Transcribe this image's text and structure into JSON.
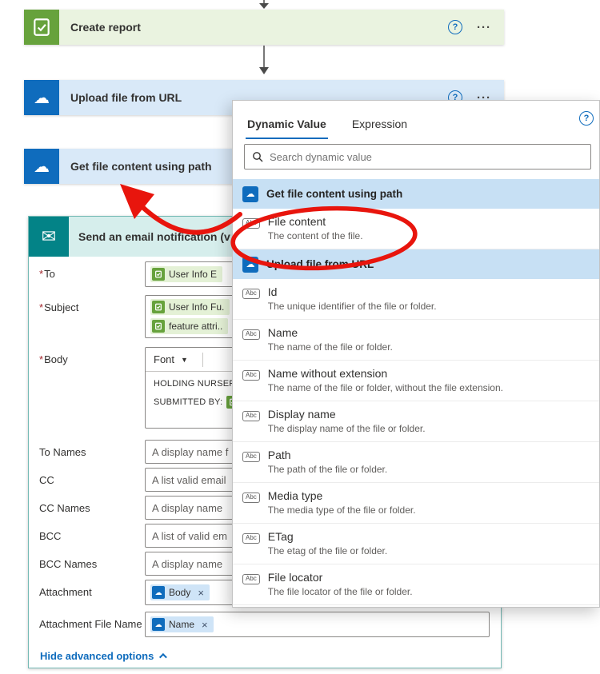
{
  "flow": {
    "create_report": {
      "title": "Create report",
      "help": "?",
      "more": "···"
    },
    "upload_file": {
      "title": "Upload file from URL",
      "help": "?",
      "more": "···"
    },
    "get_file": {
      "title": "Get file content using path"
    },
    "email": {
      "title": "Send an email notification (v",
      "req": "*",
      "fields": {
        "to": {
          "label": "To",
          "token": "User Info E"
        },
        "subject": {
          "label": "Subject",
          "token1": "User Info Fu.",
          "token2": "feature attri.."
        },
        "body": {
          "label": "Body",
          "font": "Font",
          "line1": "HOLDING NURSERY",
          "line2": "SUBMITTED BY:"
        },
        "to_names": {
          "label": "To Names",
          "placeholder": "A display name f"
        },
        "cc": {
          "label": "CC",
          "placeholder": "A list valid email"
        },
        "cc_names": {
          "label": "CC Names",
          "placeholder": "A display name"
        },
        "bcc": {
          "label": "BCC",
          "placeholder": "A list of valid em"
        },
        "bcc_names": {
          "label": "BCC Names",
          "placeholder": "A display name"
        },
        "attachment": {
          "label": "Attachment",
          "token": "Body",
          "remove": "×"
        },
        "attachment_file_name": {
          "label": "Attachment File Name",
          "token": "Name",
          "remove": "×"
        }
      },
      "footer_link": "Hide advanced options"
    }
  },
  "popup": {
    "help": "?",
    "tabs": [
      {
        "label": "Dynamic Value"
      },
      {
        "label": "Expression"
      }
    ],
    "search_placeholder": "Search dynamic value",
    "badge": "Abc",
    "groups": [
      {
        "header": "Get file content using path",
        "items": [
          {
            "title": "File content",
            "desc": "The content of the file."
          }
        ]
      },
      {
        "header": "Upload file from URL",
        "items": [
          {
            "title": "Id",
            "desc": "The unique identifier of the file or folder."
          },
          {
            "title": "Name",
            "desc": "The name of the file or folder."
          },
          {
            "title": "Name without extension",
            "desc": "The name of the file or folder, without the file extension."
          },
          {
            "title": "Display name",
            "desc": "The display name of the file or folder."
          },
          {
            "title": "Path",
            "desc": "The path of the file or folder."
          },
          {
            "title": "Media type",
            "desc": "The media type of the file or folder."
          },
          {
            "title": "ETag",
            "desc": "The etag of the file or folder."
          },
          {
            "title": "File locator",
            "desc": "The file locator of the file or folder."
          }
        ]
      }
    ]
  },
  "colors": {
    "accent_blue": "#0f6cbd",
    "green": "#67a23c",
    "teal": "#038387",
    "annotation_red": "#e8150d"
  }
}
